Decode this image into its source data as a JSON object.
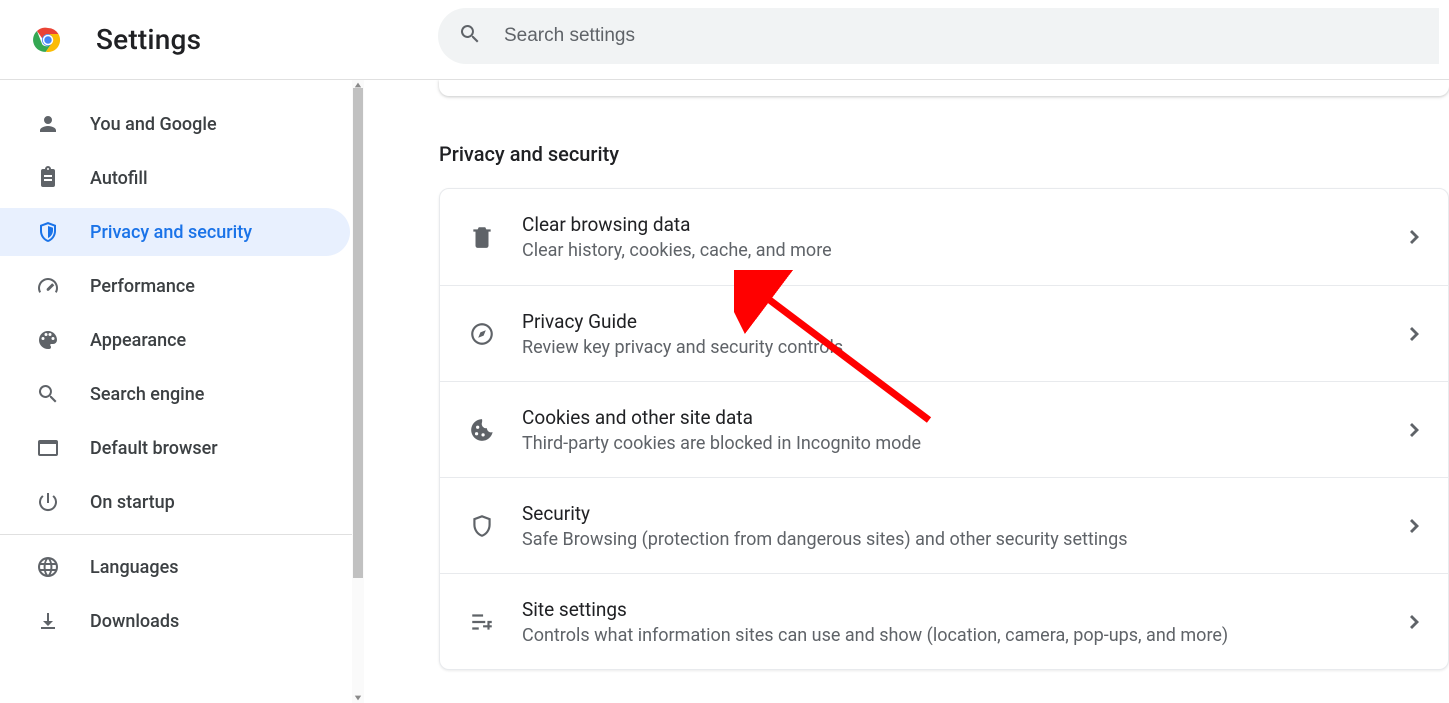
{
  "header": {
    "title": "Settings",
    "search_placeholder": "Search settings"
  },
  "sidebar": {
    "items": [
      {
        "id": "you-and-google",
        "label": "You and Google"
      },
      {
        "id": "autofill",
        "label": "Autofill"
      },
      {
        "id": "privacy-and-security",
        "label": "Privacy and security",
        "active": true
      },
      {
        "id": "performance",
        "label": "Performance"
      },
      {
        "id": "appearance",
        "label": "Appearance"
      },
      {
        "id": "search-engine",
        "label": "Search engine"
      },
      {
        "id": "default-browser",
        "label": "Default browser"
      },
      {
        "id": "on-startup",
        "label": "On startup"
      }
    ],
    "secondary": [
      {
        "id": "languages",
        "label": "Languages"
      },
      {
        "id": "downloads",
        "label": "Downloads"
      }
    ]
  },
  "section": {
    "title": "Privacy and security",
    "rows": [
      {
        "id": "clear-browsing-data",
        "title": "Clear browsing data",
        "sub": "Clear history, cookies, cache, and more"
      },
      {
        "id": "privacy-guide",
        "title": "Privacy Guide",
        "sub": "Review key privacy and security controls"
      },
      {
        "id": "cookies",
        "title": "Cookies and other site data",
        "sub": "Third-party cookies are blocked in Incognito mode"
      },
      {
        "id": "security",
        "title": "Security",
        "sub": "Safe Browsing (protection from dangerous sites) and other security settings"
      },
      {
        "id": "site-settings",
        "title": "Site settings",
        "sub": "Controls what information sites can use and show (location, camera, pop-ups, and more)"
      }
    ]
  },
  "annotation": {
    "type": "red-arrow",
    "target": "clear-browsing-data"
  }
}
